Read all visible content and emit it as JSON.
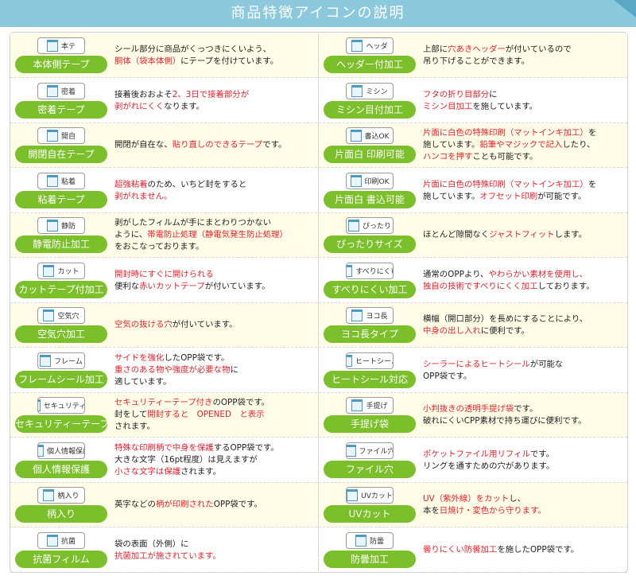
{
  "header": {
    "title": "商品特徴アイコンの説明"
  },
  "left": [
    {
      "icon_text": "本テ",
      "label": "本体側テープ",
      "lines": [
        [
          [
            "シール部分に商品がくっつきにくいよう、",
            false
          ]
        ],
        [
          [
            "胴体（袋本体側）",
            true
          ],
          [
            "にテープを付けています。",
            false
          ]
        ]
      ]
    },
    {
      "icon_text": "密着",
      "label": "密着テープ",
      "lines": [
        [
          [
            "接着後おおよそ",
            false
          ],
          [
            "2、3日で接着部分が",
            true
          ]
        ],
        [
          [
            "剥がれにくく",
            true
          ],
          [
            "なります。",
            false
          ]
        ]
      ]
    },
    {
      "icon_text": "開自",
      "label": "開閉自在テープ",
      "lines": [
        [
          [
            "開閉が自在な、",
            false
          ],
          [
            "貼り直しのできるテープ",
            true
          ],
          [
            "です。",
            false
          ]
        ]
      ]
    },
    {
      "icon_text": "粘着",
      "label": "粘着テープ",
      "lines": [
        [
          [
            "超強粘着",
            true
          ],
          [
            "のため、いちど封をすると",
            false
          ]
        ],
        [
          [
            "剥がれません。",
            true
          ]
        ]
      ]
    },
    {
      "icon_text": "静防",
      "label": "静電防止加工",
      "lines": [
        [
          [
            "剥がしたフィルムが手にまとわりつかない",
            false
          ]
        ],
        [
          [
            "ように、",
            false
          ],
          [
            "帯電防止処理（静電気発生防止処理）",
            true
          ]
        ],
        [
          [
            "をおこなっております。",
            false
          ]
        ]
      ]
    },
    {
      "icon_text": "カット",
      "label": "カットテープ付加工",
      "lines": [
        [
          [
            "開封時にすぐに開けられる",
            true
          ]
        ],
        [
          [
            "便利な",
            false
          ],
          [
            "赤いカットテープ",
            true
          ],
          [
            "が付いています。",
            false
          ]
        ]
      ]
    },
    {
      "icon_text": "空気穴",
      "label": "空気穴加工",
      "lines": [
        [
          [
            "空気の抜ける穴",
            true
          ],
          [
            "が付いています。",
            false
          ]
        ]
      ]
    },
    {
      "icon_text": "フレーム",
      "label": "フレームシール加工",
      "lines": [
        [
          [
            "サイドを強化",
            true
          ],
          [
            "したOPP袋です。",
            false
          ]
        ],
        [
          [
            "重さのある物や強度が必要な物",
            true
          ],
          [
            "に",
            false
          ]
        ],
        [
          [
            "適しています。",
            false
          ]
        ]
      ]
    },
    {
      "icon_text": "セキュリティー",
      "label": "セキュリティーテープ",
      "lines": [
        [
          [
            "セキュリティーテープ付き",
            true
          ],
          [
            "のOPP袋です。",
            false
          ]
        ],
        [
          [
            "封をして",
            false
          ],
          [
            "開封すると　OPENED　と表示",
            true
          ]
        ],
        [
          [
            "されます。",
            false
          ]
        ]
      ]
    },
    {
      "icon_text": "個人情報保護",
      "label": "個人情報保護",
      "lines": [
        [
          [
            "特殊な印刷柄で中身を保護",
            true
          ],
          [
            "するOPP袋です。",
            false
          ]
        ],
        [
          [
            "大きな文字（16pt程度）は見えますが",
            false
          ]
        ],
        [
          [
            "小さな文字は保護",
            true
          ],
          [
            "されます。",
            false
          ]
        ]
      ]
    },
    {
      "icon_text": "柄入り",
      "label": "柄入り",
      "lines": [
        [
          [
            "英字などの",
            false
          ],
          [
            "柄が印刷された",
            true
          ],
          [
            "OPP袋です。",
            false
          ]
        ]
      ]
    },
    {
      "icon_text": "抗菌",
      "label": "抗菌フィルム",
      "lines": [
        [
          [
            "袋の表面（外側）に",
            false
          ]
        ],
        [
          [
            "抗菌加工が施されています。",
            true
          ]
        ]
      ]
    }
  ],
  "right": [
    {
      "icon_text": "ヘッダ",
      "label": "ヘッダー付加工",
      "lines": [
        [
          [
            "上部に",
            false
          ],
          [
            "穴あきヘッダー",
            true
          ],
          [
            "が付いているので",
            false
          ]
        ],
        [
          [
            "吊り下げることができます。",
            false
          ]
        ]
      ]
    },
    {
      "icon_text": "ミシン",
      "label": "ミシン目付加工",
      "lines": [
        [
          [
            "フタの折り目部分",
            true
          ],
          [
            "に",
            false
          ]
        ],
        [
          [
            "ミシン目加工",
            true
          ],
          [
            "を施しています。",
            false
          ]
        ]
      ]
    },
    {
      "icon_text": "書込OK",
      "label": "片面白 印刷可能",
      "lines": [
        [
          [
            "片面に白色の特殊印刷（マットインキ加工）",
            true
          ],
          [
            "を",
            false
          ]
        ],
        [
          [
            "施しています。",
            false
          ],
          [
            "鉛筆やマジックで記入",
            true
          ],
          [
            "したり、",
            false
          ]
        ],
        [
          [
            "ハンコを押す",
            true
          ],
          [
            "ことも可能です。",
            false
          ]
        ]
      ]
    },
    {
      "icon_text": "印刷OK",
      "label": "片面白 書込可能",
      "lines": [
        [
          [
            "片面に白色の特殊印刷（マットインキ加工）",
            true
          ],
          [
            "を",
            false
          ]
        ],
        [
          [
            "施しています。",
            false
          ],
          [
            "オフセット印刷",
            true
          ],
          [
            "が可能です。",
            false
          ]
        ]
      ]
    },
    {
      "icon_text": "ぴったり",
      "label": "ぴったりサイズ",
      "lines": [
        [
          [
            "ほとんど隙間なく",
            false
          ],
          [
            "ジャストフィット",
            true
          ],
          [
            "します。",
            false
          ]
        ]
      ]
    },
    {
      "icon_text": "すべりにくい",
      "label": "すべりにくい加工",
      "lines": [
        [
          [
            "通常のOPPより、",
            false
          ],
          [
            "やわらかい素材を使用し、",
            true
          ]
        ],
        [
          [
            "独自の技術ですべりにくく加工",
            true
          ],
          [
            "しております。",
            false
          ]
        ]
      ]
    },
    {
      "icon_text": "ヨコ長",
      "label": "ヨコ長タイプ",
      "lines": [
        [
          [
            "横幅（開口部分）を長めにすることにより、",
            false
          ]
        ],
        [
          [
            "中身の出し入れ",
            true
          ],
          [
            "に便利です。",
            false
          ]
        ]
      ]
    },
    {
      "icon_text": "ヒートシール",
      "label": "ヒートシール対応",
      "lines": [
        [
          [
            "シーラーによるヒートシール",
            true
          ],
          [
            "が可能な",
            false
          ]
        ],
        [
          [
            "OPP袋です。",
            false
          ]
        ]
      ]
    },
    {
      "icon_text": "手提げ",
      "label": "手提げ袋",
      "lines": [
        [
          [
            "小判抜きの透明手提げ袋",
            true
          ],
          [
            "です。",
            false
          ]
        ],
        [
          [
            "破れにくいCPP素材で持ち運びに便利です。",
            false
          ]
        ]
      ]
    },
    {
      "icon_text": "ファイル穴",
      "label": "ファイル穴",
      "lines": [
        [
          [
            "ポケットファイル用リフィル",
            true
          ],
          [
            "です。",
            false
          ]
        ],
        [
          [
            "リングを通すための穴があります。",
            false
          ]
        ]
      ]
    },
    {
      "icon_text": "UVカット",
      "label": "UVカット",
      "lines": [
        [
          [
            "UV（紫外線）をカット",
            true
          ],
          [
            "し、",
            false
          ]
        ],
        [
          [
            "本を",
            false
          ],
          [
            "日焼け・変色から守ります。",
            true
          ]
        ]
      ]
    },
    {
      "icon_text": "防曇",
      "label": "防曇加工",
      "lines": [
        [
          [
            "曇りにくい防曇加工",
            true
          ],
          [
            "を施したOPP袋です。",
            false
          ]
        ]
      ]
    }
  ]
}
